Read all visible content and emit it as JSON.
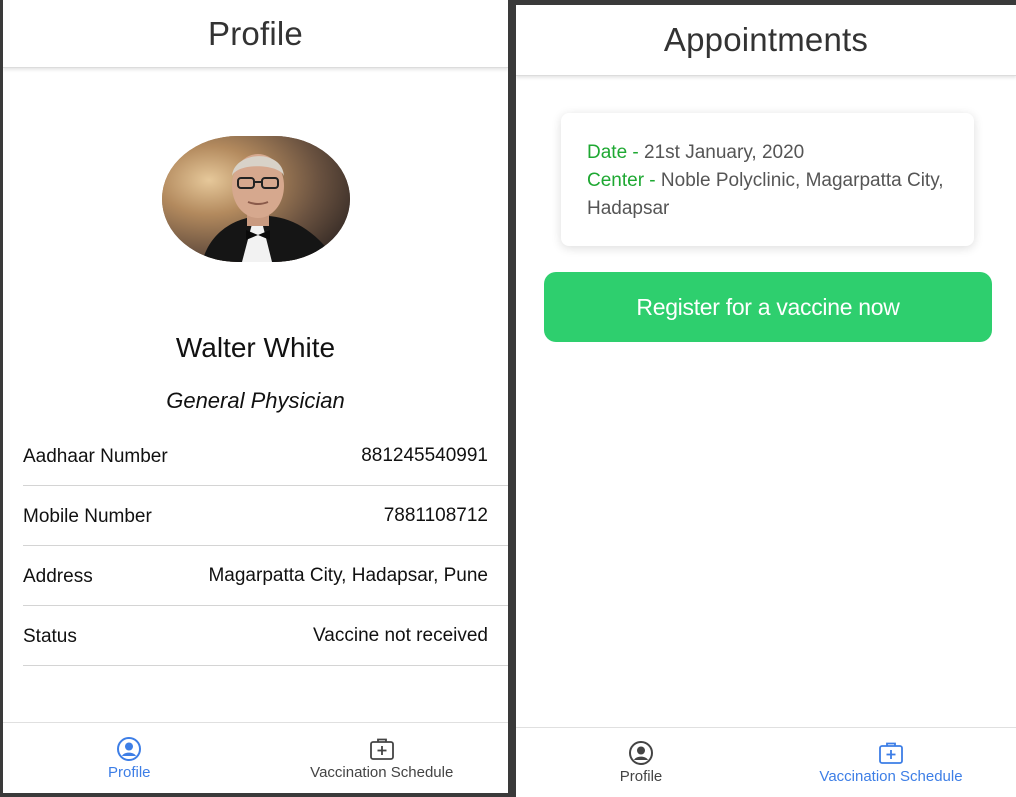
{
  "profile_screen": {
    "header": {
      "title": "Profile"
    },
    "user": {
      "name": "Walter White",
      "role": "General Physician"
    },
    "info_rows": [
      {
        "label": "Aadhaar Number",
        "value": "881245540991"
      },
      {
        "label": "Mobile Number",
        "value": "7881108712"
      },
      {
        "label": "Address",
        "value": "Magarpatta City, Hadapsar, Pune"
      },
      {
        "label": "Status",
        "value": "Vaccine not received"
      }
    ],
    "tabs": [
      {
        "label": "Profile",
        "icon": "person-circle-icon",
        "active": true
      },
      {
        "label": "Vaccination Schedule",
        "icon": "medical-kit-icon",
        "active": false
      }
    ]
  },
  "appointments_screen": {
    "header": {
      "title": "Appointments"
    },
    "card": {
      "date_key": "Date - ",
      "date_value": "21st January, 2020",
      "center_key": "Center - ",
      "center_value": "Noble Polyclinic, Magarpatta City, Hadapsar"
    },
    "register_button": {
      "label": "Register for a vaccine now"
    },
    "tabs": [
      {
        "label": "Profile",
        "icon": "person-circle-icon",
        "active": false
      },
      {
        "label": "Vaccination Schedule",
        "icon": "medical-kit-icon",
        "active": true
      }
    ]
  },
  "colors": {
    "accent_blue": "#3d7ee6",
    "key_green": "#1ea832",
    "button_green": "#2ecf6e"
  }
}
